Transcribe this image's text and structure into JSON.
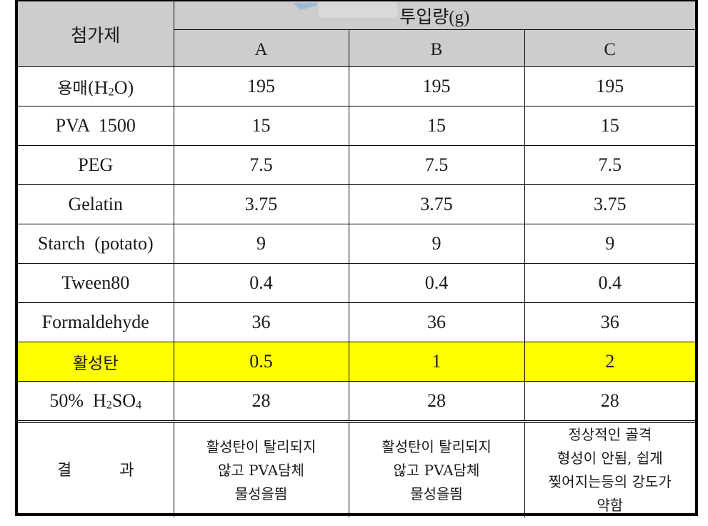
{
  "header": {
    "additive_label": "첨가제",
    "amount_label": "투입량(g)",
    "columns": [
      "A",
      "B",
      "C"
    ]
  },
  "rows": [
    {
      "name": "용매(H",
      "name_sub": "2",
      "name_tail": "O)",
      "values": [
        "195",
        "195",
        "195"
      ]
    },
    {
      "name": "PVA  1500",
      "values": [
        "15",
        "15",
        "15"
      ]
    },
    {
      "name": "PEG",
      "values": [
        "7.5",
        "7.5",
        "7.5"
      ]
    },
    {
      "name": "Gelatin",
      "values": [
        "3.75",
        "3.75",
        "3.75"
      ]
    },
    {
      "name": "Starch  (potato)",
      "values": [
        "9",
        "9",
        "9"
      ]
    },
    {
      "name": "Tween80",
      "values": [
        "0.4",
        "0.4",
        "0.4"
      ]
    },
    {
      "name": "Formaldehyde",
      "values": [
        "36",
        "36",
        "36"
      ]
    },
    {
      "name": "활성탄",
      "values": [
        "0.5",
        "1",
        "2"
      ],
      "highlight_color": "#ffff00"
    },
    {
      "name": "50%  H",
      "name_sub": "2",
      "name_mid": "SO",
      "name_sub2": "4",
      "values": [
        "28",
        "28",
        "28"
      ]
    }
  ],
  "result": {
    "label": "결 과",
    "values": [
      "활성탄이 탈리되지\n않고  PVA담체\n물성을띔",
      "활성탄이 탈리되지\n않고  PVA담체\n물성을띔",
      "정상적인 골격\n형성이 안됨, 쉽게\n찢어지는등의 강도가\n약함"
    ]
  }
}
